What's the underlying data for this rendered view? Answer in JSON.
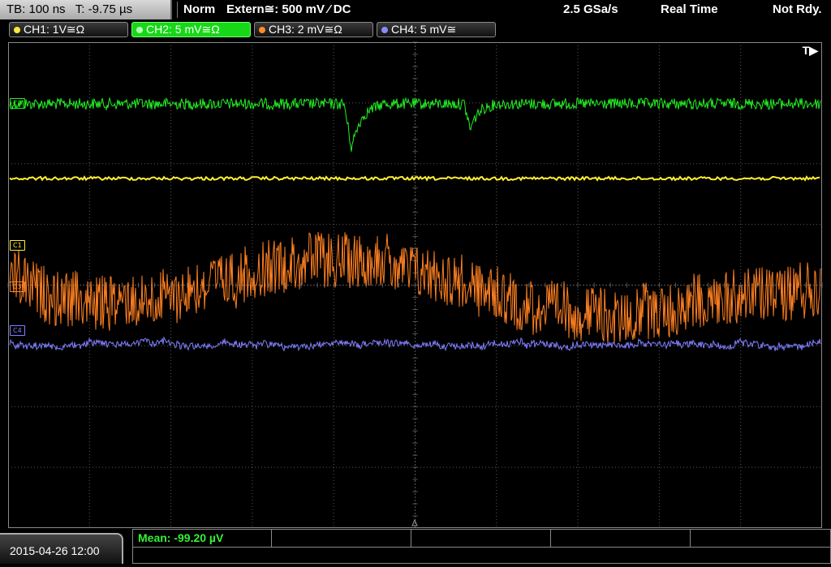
{
  "status_bar": {
    "timebase": "TB: 100 ns   T: -9.75 µs",
    "mode": "Norm",
    "trigger": "Extern≅: 500 mV ⁄ DC",
    "sample_rate": "2.5 GSa/s",
    "acq_mode": "Real Time",
    "state": "Not Rdy."
  },
  "channels": [
    {
      "label": "CH1: 1V≅Ω",
      "color": "#ffe640",
      "active": false
    },
    {
      "label": "CH2: 5 mV≅Ω",
      "color": "#30e030",
      "active": true
    },
    {
      "label": "CH3: 2 mV≅Ω",
      "color": "#ff8a2a",
      "active": false
    },
    {
      "label": "CH4: 5 mV≅",
      "color": "#8a8aff",
      "active": false
    }
  ],
  "markers": {
    "c2": "C2",
    "c1": "C1",
    "c3": "C3",
    "c4": "C4"
  },
  "trigger_marker": "T▶",
  "measurement": "Mean: -99.20 µV",
  "datetime": "2015-04-26 12:00",
  "colors": {
    "ch1": "#ffee33",
    "ch2": "#22ee22",
    "ch3": "#ff8020",
    "ch4": "#7f7fff",
    "grid": "#5a5a5a"
  }
}
